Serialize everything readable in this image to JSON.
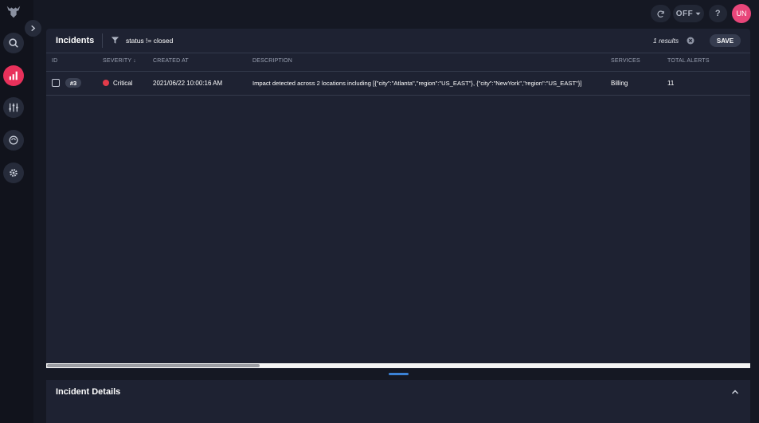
{
  "topbar": {
    "live_toggle_label": "OFF",
    "user_initials": "UN"
  },
  "incidents": {
    "title": "Incidents",
    "filter_query": "status != closed",
    "results_text": "1 results",
    "save_label": "SAVE",
    "columns": [
      "ID",
      "SEVERITY ↓",
      "CREATED AT",
      "DESCRIPTION",
      "SERVICES",
      "TOTAL ALERTS"
    ],
    "rows": [
      {
        "id": "#3",
        "severity": "Critical",
        "created_at": "2021/06/22 10:00:16 AM",
        "description": "Impact detected across 2 locations including [{\"city\":\"Atlanta\",\"region\":\"US_EAST\"}, {\"city\":\"NewYork\",\"region\":\"US_EAST\"}]",
        "services": "Billing",
        "total_alerts": "11"
      }
    ]
  },
  "details": {
    "title": "Incident Details"
  },
  "colors": {
    "accent": "#e8315b",
    "critical": "#e23b4a",
    "avatar": "#e8467a"
  }
}
